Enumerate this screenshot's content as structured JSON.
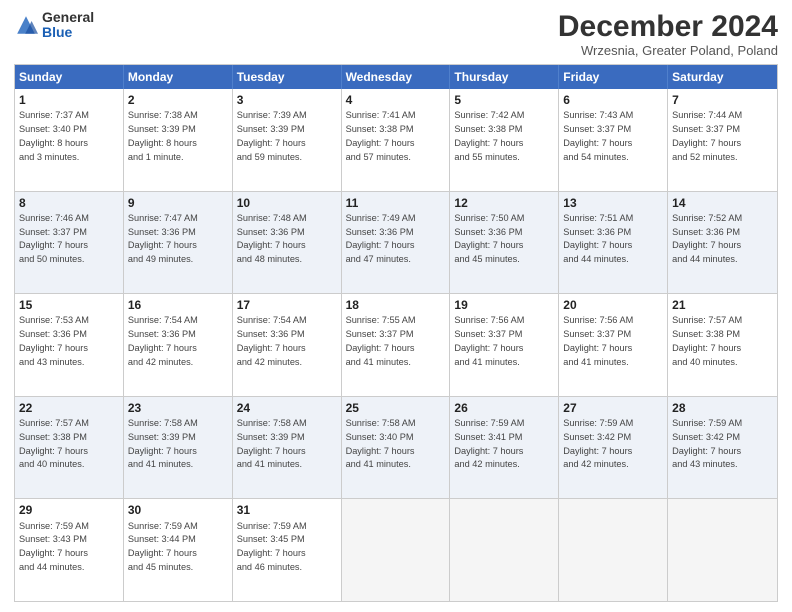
{
  "header": {
    "logo_general": "General",
    "logo_blue": "Blue",
    "title": "December 2024",
    "subtitle": "Wrzesnia, Greater Poland, Poland"
  },
  "weekdays": [
    "Sunday",
    "Monday",
    "Tuesday",
    "Wednesday",
    "Thursday",
    "Friday",
    "Saturday"
  ],
  "rows": [
    [
      {
        "day": "1",
        "text": "Sunrise: 7:37 AM\nSunset: 3:40 PM\nDaylight: 8 hours\nand 3 minutes."
      },
      {
        "day": "2",
        "text": "Sunrise: 7:38 AM\nSunset: 3:39 PM\nDaylight: 8 hours\nand 1 minute."
      },
      {
        "day": "3",
        "text": "Sunrise: 7:39 AM\nSunset: 3:39 PM\nDaylight: 7 hours\nand 59 minutes."
      },
      {
        "day": "4",
        "text": "Sunrise: 7:41 AM\nSunset: 3:38 PM\nDaylight: 7 hours\nand 57 minutes."
      },
      {
        "day": "5",
        "text": "Sunrise: 7:42 AM\nSunset: 3:38 PM\nDaylight: 7 hours\nand 55 minutes."
      },
      {
        "day": "6",
        "text": "Sunrise: 7:43 AM\nSunset: 3:37 PM\nDaylight: 7 hours\nand 54 minutes."
      },
      {
        "day": "7",
        "text": "Sunrise: 7:44 AM\nSunset: 3:37 PM\nDaylight: 7 hours\nand 52 minutes."
      }
    ],
    [
      {
        "day": "8",
        "text": "Sunrise: 7:46 AM\nSunset: 3:37 PM\nDaylight: 7 hours\nand 50 minutes."
      },
      {
        "day": "9",
        "text": "Sunrise: 7:47 AM\nSunset: 3:36 PM\nDaylight: 7 hours\nand 49 minutes."
      },
      {
        "day": "10",
        "text": "Sunrise: 7:48 AM\nSunset: 3:36 PM\nDaylight: 7 hours\nand 48 minutes."
      },
      {
        "day": "11",
        "text": "Sunrise: 7:49 AM\nSunset: 3:36 PM\nDaylight: 7 hours\nand 47 minutes."
      },
      {
        "day": "12",
        "text": "Sunrise: 7:50 AM\nSunset: 3:36 PM\nDaylight: 7 hours\nand 45 minutes."
      },
      {
        "day": "13",
        "text": "Sunrise: 7:51 AM\nSunset: 3:36 PM\nDaylight: 7 hours\nand 44 minutes."
      },
      {
        "day": "14",
        "text": "Sunrise: 7:52 AM\nSunset: 3:36 PM\nDaylight: 7 hours\nand 44 minutes."
      }
    ],
    [
      {
        "day": "15",
        "text": "Sunrise: 7:53 AM\nSunset: 3:36 PM\nDaylight: 7 hours\nand 43 minutes."
      },
      {
        "day": "16",
        "text": "Sunrise: 7:54 AM\nSunset: 3:36 PM\nDaylight: 7 hours\nand 42 minutes."
      },
      {
        "day": "17",
        "text": "Sunrise: 7:54 AM\nSunset: 3:36 PM\nDaylight: 7 hours\nand 42 minutes."
      },
      {
        "day": "18",
        "text": "Sunrise: 7:55 AM\nSunset: 3:37 PM\nDaylight: 7 hours\nand 41 minutes."
      },
      {
        "day": "19",
        "text": "Sunrise: 7:56 AM\nSunset: 3:37 PM\nDaylight: 7 hours\nand 41 minutes."
      },
      {
        "day": "20",
        "text": "Sunrise: 7:56 AM\nSunset: 3:37 PM\nDaylight: 7 hours\nand 41 minutes."
      },
      {
        "day": "21",
        "text": "Sunrise: 7:57 AM\nSunset: 3:38 PM\nDaylight: 7 hours\nand 40 minutes."
      }
    ],
    [
      {
        "day": "22",
        "text": "Sunrise: 7:57 AM\nSunset: 3:38 PM\nDaylight: 7 hours\nand 40 minutes."
      },
      {
        "day": "23",
        "text": "Sunrise: 7:58 AM\nSunset: 3:39 PM\nDaylight: 7 hours\nand 41 minutes."
      },
      {
        "day": "24",
        "text": "Sunrise: 7:58 AM\nSunset: 3:39 PM\nDaylight: 7 hours\nand 41 minutes."
      },
      {
        "day": "25",
        "text": "Sunrise: 7:58 AM\nSunset: 3:40 PM\nDaylight: 7 hours\nand 41 minutes."
      },
      {
        "day": "26",
        "text": "Sunrise: 7:59 AM\nSunset: 3:41 PM\nDaylight: 7 hours\nand 42 minutes."
      },
      {
        "day": "27",
        "text": "Sunrise: 7:59 AM\nSunset: 3:42 PM\nDaylight: 7 hours\nand 42 minutes."
      },
      {
        "day": "28",
        "text": "Sunrise: 7:59 AM\nSunset: 3:42 PM\nDaylight: 7 hours\nand 43 minutes."
      }
    ],
    [
      {
        "day": "29",
        "text": "Sunrise: 7:59 AM\nSunset: 3:43 PM\nDaylight: 7 hours\nand 44 minutes."
      },
      {
        "day": "30",
        "text": "Sunrise: 7:59 AM\nSunset: 3:44 PM\nDaylight: 7 hours\nand 45 minutes."
      },
      {
        "day": "31",
        "text": "Sunrise: 7:59 AM\nSunset: 3:45 PM\nDaylight: 7 hours\nand 46 minutes."
      },
      {
        "day": "",
        "text": ""
      },
      {
        "day": "",
        "text": ""
      },
      {
        "day": "",
        "text": ""
      },
      {
        "day": "",
        "text": ""
      }
    ]
  ]
}
